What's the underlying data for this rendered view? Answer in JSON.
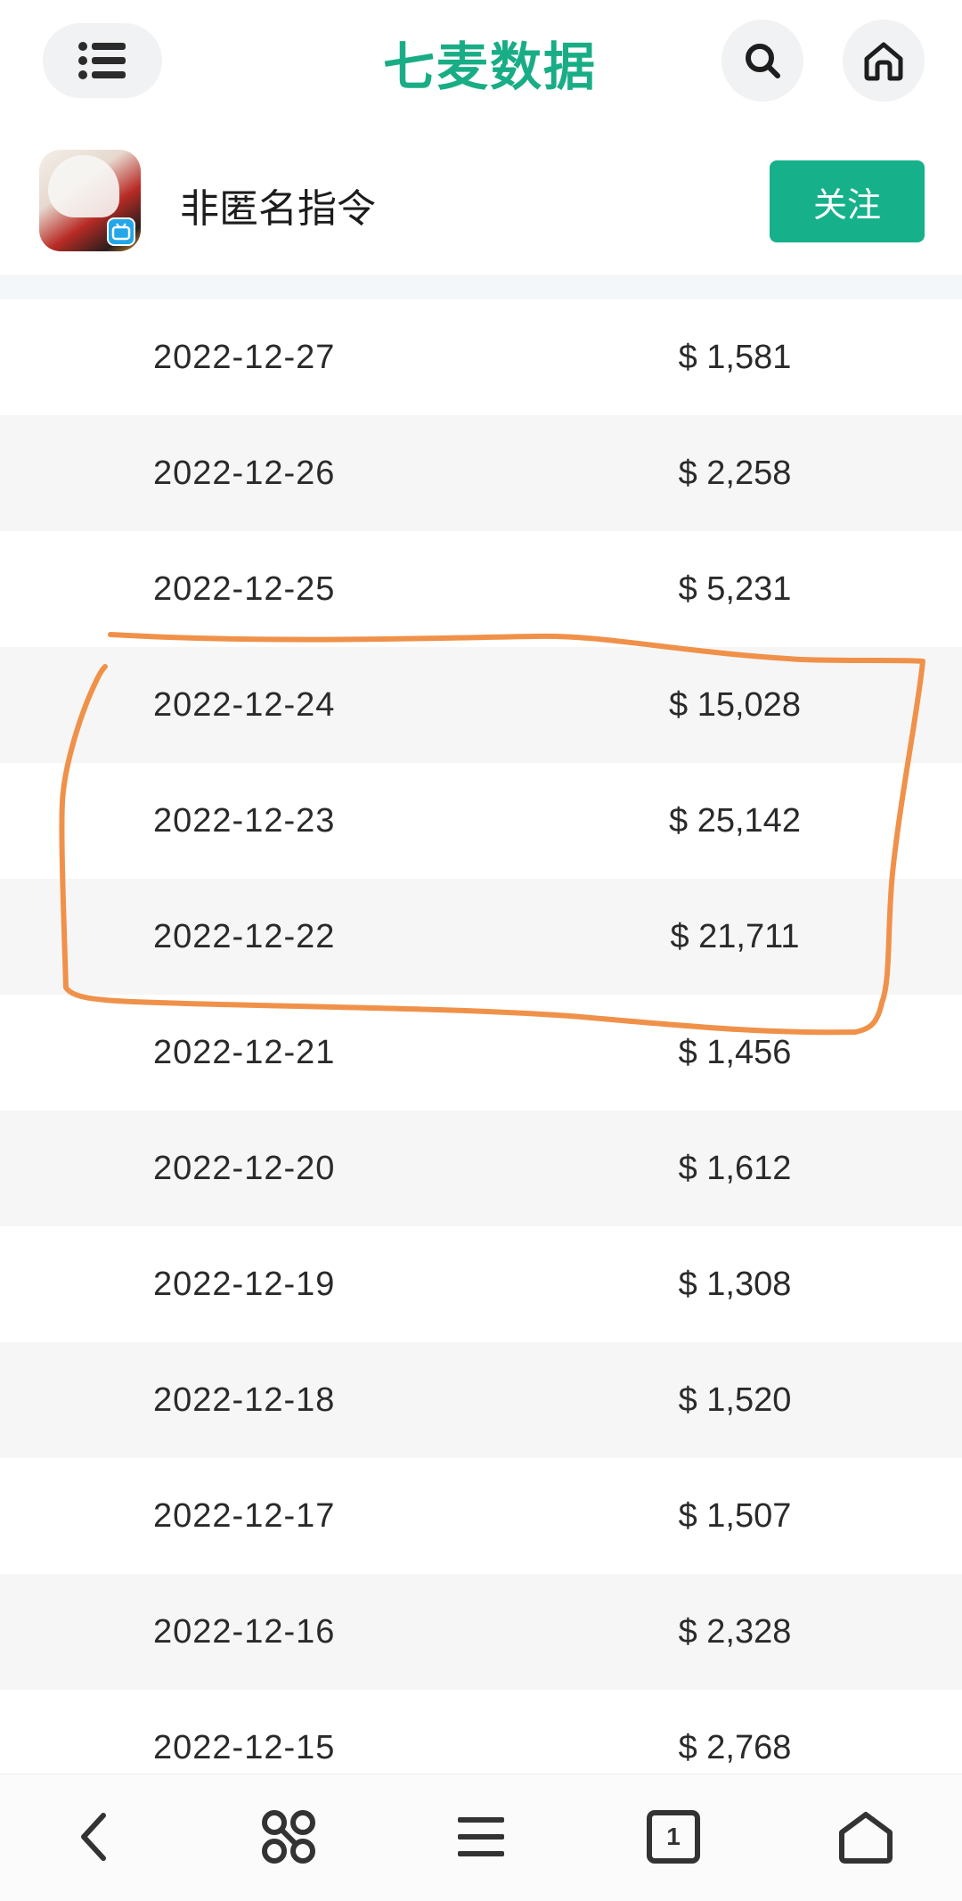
{
  "header": {
    "logo_text": "七麦数据",
    "brand_color": "#19ad85"
  },
  "app": {
    "name": "非匿名指令",
    "follow_label": "关注"
  },
  "table": {
    "rows": [
      {
        "date": "2022-12-27",
        "amount": "$ 1,581"
      },
      {
        "date": "2022-12-26",
        "amount": "$ 2,258"
      },
      {
        "date": "2022-12-25",
        "amount": "$ 5,231"
      },
      {
        "date": "2022-12-24",
        "amount": "$ 15,028"
      },
      {
        "date": "2022-12-23",
        "amount": "$ 25,142"
      },
      {
        "date": "2022-12-22",
        "amount": "$ 21,711"
      },
      {
        "date": "2022-12-21",
        "amount": "$ 1,456"
      },
      {
        "date": "2022-12-20",
        "amount": "$ 1,612"
      },
      {
        "date": "2022-12-19",
        "amount": "$ 1,308"
      },
      {
        "date": "2022-12-18",
        "amount": "$ 1,520"
      },
      {
        "date": "2022-12-17",
        "amount": "$ 1,507"
      },
      {
        "date": "2022-12-16",
        "amount": "$ 2,328"
      },
      {
        "date": "2022-12-15",
        "amount": "$ 2,768"
      }
    ]
  },
  "annotation": {
    "color": "#f0914a",
    "highlighted_dates": [
      "2022-12-24",
      "2022-12-23",
      "2022-12-22"
    ]
  },
  "bottom_nav": {
    "tab_count": "1",
    "icons": [
      "back-icon",
      "apps-icon",
      "menu-icon",
      "tabs-icon",
      "home-icon"
    ]
  }
}
